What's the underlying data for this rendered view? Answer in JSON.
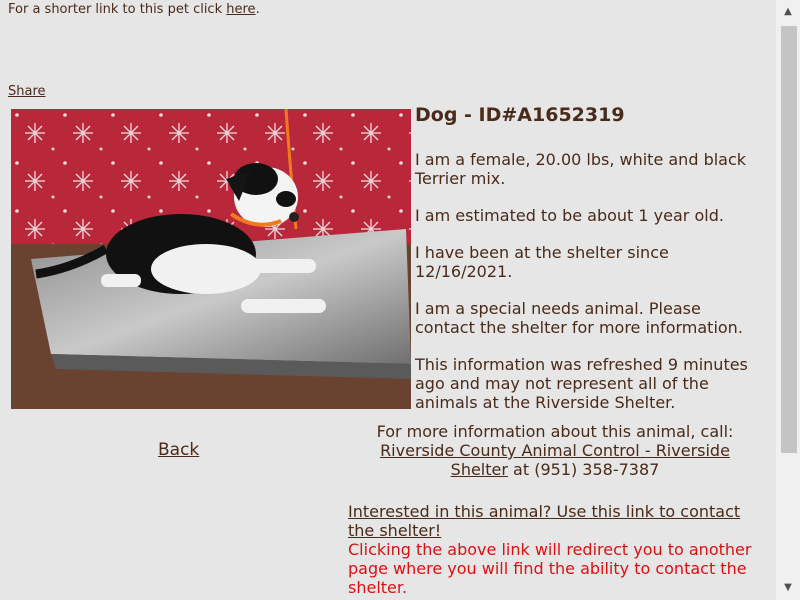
{
  "header": {
    "shorter_link_prefix": "For a shorter link to this pet click",
    "shorter_link_label": "here",
    "shorter_link_suffix": ".",
    "share_label": "Share"
  },
  "pet": {
    "title": "Dog - ID#A1652319",
    "photo_alt": "Black and white Terrier mix dog lying on a scale",
    "details": [
      "I am a female, 20.00 lbs, white and black Terrier mix.",
      "I am estimated to be about 1 year old.",
      "I have been at the shelter since 12/16/2021.",
      "I am a special needs animal. Please contact the shelter for more information.",
      "This information was refreshed 9 minutes ago and may not represent all of the animals at the Riverside Shelter."
    ]
  },
  "nav": {
    "back_label": "Back"
  },
  "info": {
    "call_prefix": "For more information about this animal, call:",
    "shelter_link": "Riverside County Animal Control - Riverside Shelter",
    "phone_text": "at (951) 358-7387"
  },
  "contact": {
    "link_label": "Interested in this animal? Use this link to contact the shelter!",
    "warning": "Clicking the above link will redirect you to another page where you will find the ability to contact the shelter."
  },
  "colors": {
    "text": "#4a2a18",
    "warning": "#e01010",
    "background": "#e6e6e6"
  },
  "icons": {
    "scroll_up": "triangle-up-icon",
    "scroll_down": "triangle-down-icon"
  }
}
